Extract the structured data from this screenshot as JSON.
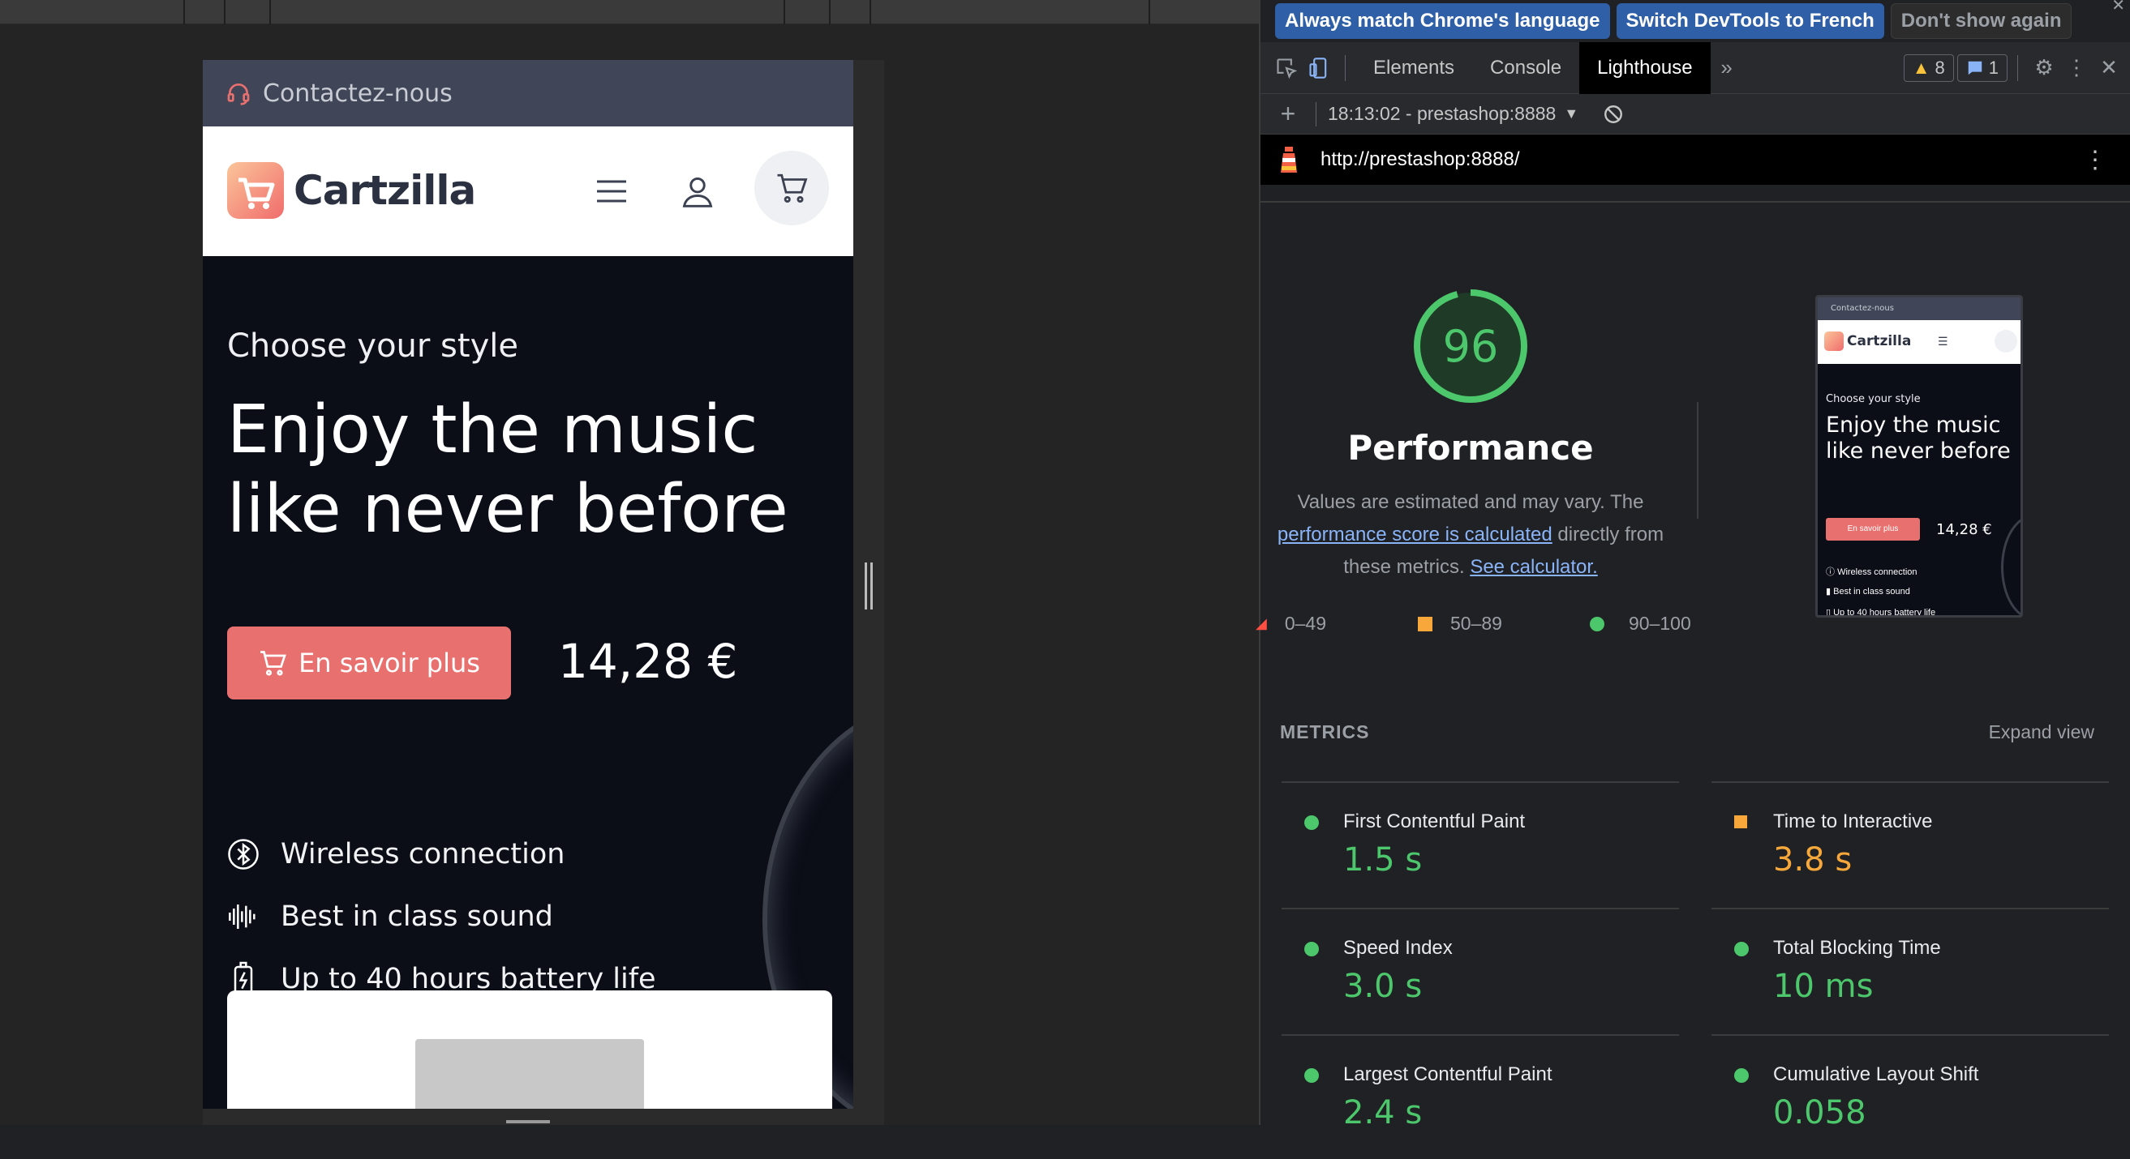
{
  "page": {
    "topbar": {
      "contact_label": "Contactez-nous"
    },
    "brand": {
      "name": "Cartzilla"
    },
    "hero": {
      "subtitle": "Choose your style",
      "title": "Enjoy the music like never before",
      "cta_label": "En savoir plus",
      "price": "14,28 €"
    },
    "features": [
      {
        "icon": "bluetooth-icon",
        "label": "Wireless connection"
      },
      {
        "icon": "soundwave-icon",
        "label": "Best in class sound"
      },
      {
        "icon": "battery-icon",
        "label": "Up to 40 hours battery life"
      }
    ]
  },
  "devtools": {
    "infobar": {
      "match_language": "Always match Chrome's language",
      "switch_french": "Switch DevTools to French",
      "dont_show": "Don't show again"
    },
    "tabs": [
      "Elements",
      "Console",
      "Lighthouse"
    ],
    "active_tab": "Lighthouse",
    "warnings_count": "8",
    "messages_count": "1",
    "report_selector": "18:13:02 - prestashop:8888",
    "url": "http://prestashop:8888/",
    "performance": {
      "score": "96",
      "score_fraction": 0.96,
      "title": "Performance",
      "desc_1": "Values are estimated and may vary. The",
      "desc_link": "performance score is calculated",
      "desc_2": "directly from",
      "desc_3": "these metrics.",
      "calc_link": "See calculator."
    },
    "legend": [
      {
        "range": "0–49",
        "color": "#ff4e42"
      },
      {
        "range": "50–89",
        "color": "#f8a83a"
      },
      {
        "range": "90–100",
        "color": "#4cc76b"
      }
    ],
    "thumbnail": {
      "contact": "Contactez-nous",
      "brand": "Cartzilla",
      "subtitle": "Choose your style",
      "title": "Enjoy the music like never before",
      "cta": "En savoir plus",
      "price": "14,28 €",
      "feature_1": "Wireless connection",
      "feature_2": "Best in class sound",
      "feature_3": "Up to 40 hours battery life"
    },
    "metrics_header": "METRICS",
    "expand_view": "Expand view",
    "metrics": [
      {
        "label": "First Contentful Paint",
        "value": "1.5 s",
        "status": "good"
      },
      {
        "label": "Time to Interactive",
        "value": "3.8 s",
        "status": "average"
      },
      {
        "label": "Speed Index",
        "value": "3.0 s",
        "status": "good"
      },
      {
        "label": "Total Blocking Time",
        "value": "10 ms",
        "status": "good"
      },
      {
        "label": "Largest Contentful Paint",
        "value": "2.4 s",
        "status": "good"
      },
      {
        "label": "Cumulative Layout Shift",
        "value": "0.058",
        "status": "good"
      }
    ],
    "colors": {
      "good": "#4cc76b",
      "average": "#f8a83a",
      "poor": "#ff4e42",
      "accent": "#e8706f"
    }
  }
}
